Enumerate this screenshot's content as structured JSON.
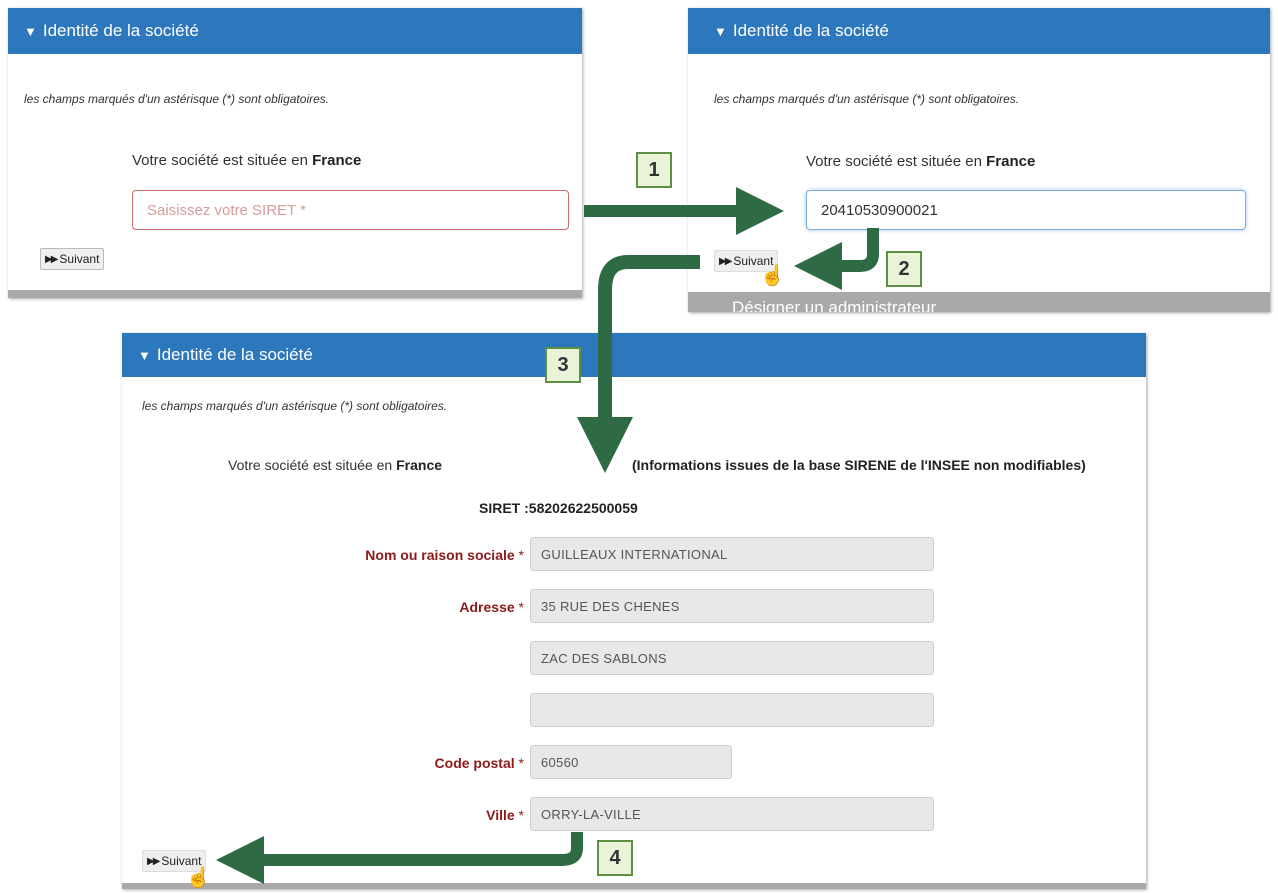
{
  "panel_title": "Identité de la société",
  "required_note": "les champs marqués d'un astérisque (*) sont obligatoires.",
  "location_prefix": "Votre société est située en",
  "location_country": "France",
  "next_button": "Suivant",
  "step1": {
    "siret_placeholder": "Saisissez votre SIRET *"
  },
  "step2": {
    "siret_value": "20410530900021",
    "hidden_section": "Désigner un administrateur"
  },
  "result": {
    "sirene_info": "(Informations issues de la base SIRENE de l'INSEE non modifiables)",
    "siret_label": "SIRET :",
    "siret_number": "58202622500059",
    "fields": {
      "name_label": "Nom ou raison sociale",
      "name_value": "GUILLEAUX INTERNATIONAL",
      "address_label": "Adresse",
      "address_line1": "35 RUE DES CHENES",
      "address_line2": "ZAC DES SABLONS",
      "address_line3": "",
      "postal_label": "Code postal",
      "postal_value": "60560",
      "city_label": "Ville",
      "city_value": "ORRY-LA-VILLE"
    },
    "asterisk": "*"
  },
  "steps": [
    "1",
    "2",
    "3",
    "4"
  ],
  "colors": {
    "header_blue": "#2d78bd",
    "arrow_green": "#2e6b45",
    "label_red": "#8b1a1a",
    "step_bg": "#e9f3d7"
  }
}
